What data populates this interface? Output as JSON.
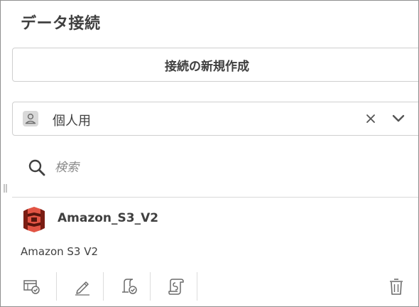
{
  "panel": {
    "title": "データ接続"
  },
  "create_button": {
    "label": "接続の新規作成"
  },
  "space_selector": {
    "value": "個人用",
    "icon": "person-icon"
  },
  "search": {
    "placeholder": "検索",
    "value": ""
  },
  "connection": {
    "name": "Amazon_S3_V2",
    "type": "Amazon S3 V2",
    "icon": "amazon-s3-icon",
    "icon_colors": [
      "#e25444",
      "#7b1d13",
      "#58150d"
    ]
  },
  "actions": [
    {
      "icon": "select-data-icon"
    },
    {
      "icon": "edit-icon"
    },
    {
      "icon": "test-connection-icon"
    },
    {
      "icon": "data-load-script-icon"
    },
    {
      "icon": "trash-icon"
    }
  ],
  "colors": {
    "text": "#404040",
    "border": "#cfcfcf",
    "placeholder": "#8a8a8a"
  }
}
